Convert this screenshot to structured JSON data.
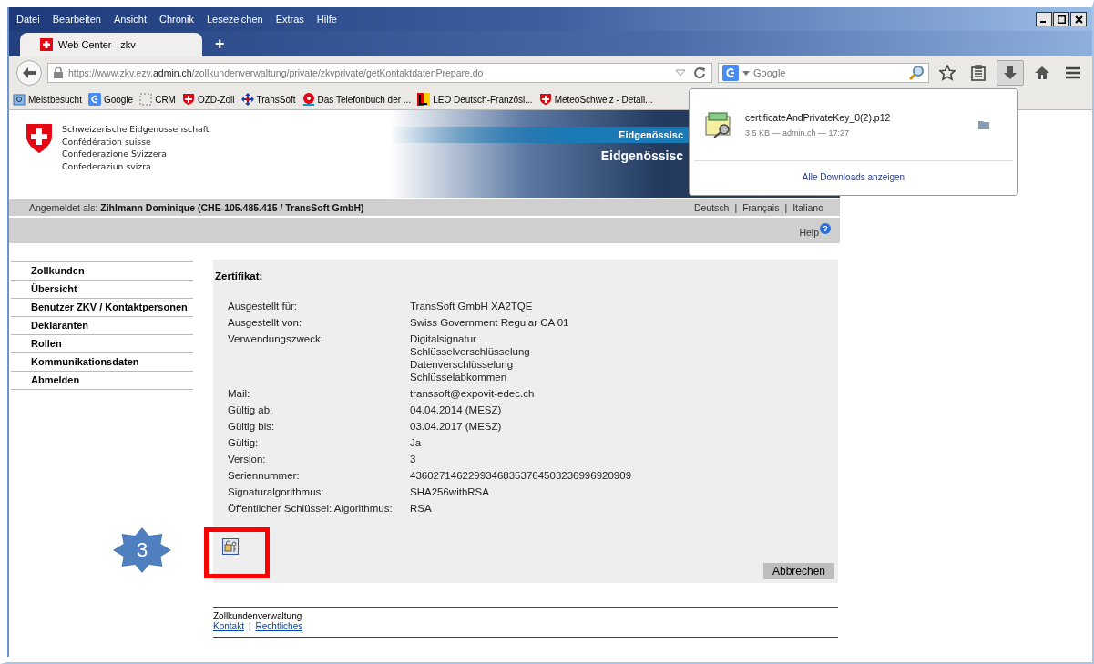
{
  "menu": [
    "Datei",
    "Bearbeiten",
    "Ansicht",
    "Chronik",
    "Lesezeichen",
    "Extras",
    "Hilfe"
  ],
  "tab": {
    "title": "Web Center - zkv",
    "new_tab": "+"
  },
  "address": {
    "parts": [
      {
        "text": "https://www.zkv.ezv.",
        "emphasis": false
      },
      {
        "text": "admin.ch",
        "emphasis": true
      },
      {
        "text": "/zollkundenverwaltung/private/zkvprivate/getKontaktdatenPrepare.do",
        "emphasis": false
      }
    ]
  },
  "search": {
    "placeholder": "Google"
  },
  "bookmarks": [
    {
      "label": "Meistbesucht",
      "kind": "folder"
    },
    {
      "label": "Google",
      "kind": "google"
    },
    {
      "label": "CRM",
      "kind": "dashed"
    },
    {
      "label": "OZD-Zoll",
      "kind": "swiss"
    },
    {
      "label": "TransSoft",
      "kind": "cross"
    },
    {
      "label": "Das Telefonbuch der ...",
      "kind": "phone"
    },
    {
      "label": "LEO Deutsch-Französi...",
      "kind": "leo"
    },
    {
      "label": "MeteoSchweiz - Detail...",
      "kind": "swiss"
    }
  ],
  "downloads": {
    "file": "certificateAndPrivateKey_0(2).p12",
    "meta": "3.5 KB — admin.ch — 17:27",
    "show_all": "Alle Downloads anzeigen"
  },
  "header": {
    "lines": [
      "Schweizerische Eidgenossenschaft",
      "Confédération suisse",
      "Confederazione Svizzera",
      "Confederaziun svizra"
    ],
    "banner_strip": "Eidgenössisc",
    "banner_title": "Eidgenössisc"
  },
  "login": {
    "label": "Angemeldet als:",
    "user": "Zihlmann Dominique (CHE-105.485.415 / TransSoft GmbH)"
  },
  "languages": [
    "Deutsch",
    "Français",
    "Italiano"
  ],
  "separator": "|",
  "help": {
    "label": "Help",
    "icon": "?"
  },
  "sidebar": [
    "Zollkunden",
    "Übersicht",
    "Benutzer ZKV / Kontaktpersonen",
    "Deklaranten",
    "Rollen",
    "Kommunikationsdaten",
    "Abmelden"
  ],
  "certificate": {
    "title": "Zertifikat:",
    "fields": [
      {
        "label": "Ausgestellt für:",
        "values": [
          "TransSoft GmbH XA2TQE"
        ]
      },
      {
        "label": "Ausgestellt von:",
        "values": [
          "Swiss Government Regular CA 01"
        ]
      },
      {
        "label": "Verwendungszweck:",
        "values": [
          "Digitalsignatur",
          "Schlüsselverschlüsselung",
          "Datenverschlüsselung",
          "Schlüsselabkommen"
        ]
      },
      {
        "label": "Mail:",
        "values": [
          "transsoft@expovit-edec.ch"
        ]
      },
      {
        "label": "Gültig ab:",
        "values": [
          "04.04.2014 (MESZ)"
        ]
      },
      {
        "label": "Gültig bis:",
        "values": [
          "03.04.2017 (MESZ)"
        ]
      },
      {
        "label": "Gültig:",
        "values": [
          "Ja"
        ]
      },
      {
        "label": "Version:",
        "values": [
          "3"
        ]
      },
      {
        "label": "Seriennummer:",
        "values": [
          "43602714622993468353764503236996920909"
        ]
      },
      {
        "label": "Signaturalgorithmus:",
        "values": [
          "SHA256withRSA"
        ]
      },
      {
        "label": "Öffentlicher Schlüssel: Algorithmus:",
        "values": [
          "RSA"
        ]
      }
    ],
    "cancel": "Abbrechen"
  },
  "callout": {
    "step": "3"
  },
  "footer": {
    "title": "Zollkundenverwaltung",
    "links": [
      "Kontakt",
      "Rechtliches"
    ]
  }
}
